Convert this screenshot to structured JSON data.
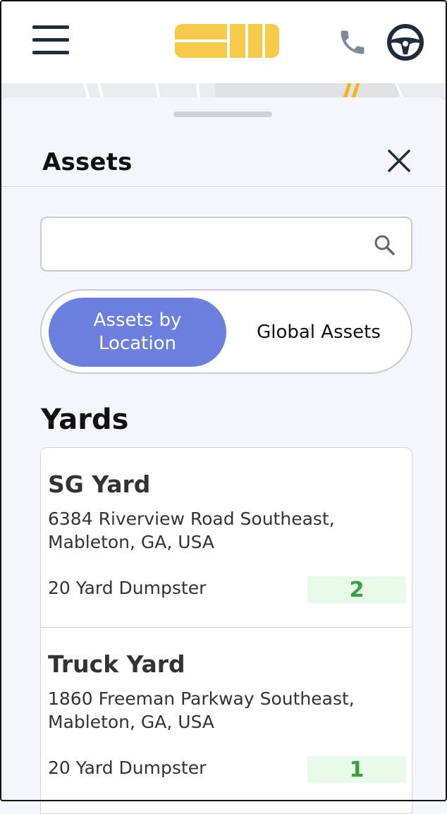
{
  "header": {
    "menu_icon": "hamburger-menu-icon",
    "logo_icon": "brand-logo",
    "phone_icon": "phone-icon",
    "wheel_icon": "steering-wheel-icon",
    "colors": {
      "logo": "#f7c948",
      "phone": "#7a8a99",
      "dark": "#1f2d3d"
    }
  },
  "sheet": {
    "title": "Assets",
    "close_icon": "close-icon",
    "search": {
      "value": "",
      "placeholder": "",
      "icon": "search-icon"
    },
    "toggle": {
      "options": [
        {
          "label_line1": "Assets by",
          "label_line2": "Location",
          "active": true
        },
        {
          "label": "Global Assets",
          "active": false
        }
      ],
      "active_color": "#6b7fdf"
    },
    "section_title": "Yards",
    "yards": [
      {
        "name": "SG Yard",
        "address_line1": "6384 Riverview Road Southeast,",
        "address_line2": "Mableton, GA, USA",
        "asset_type": "20 Yard Dumpster",
        "count": "2"
      },
      {
        "name": "Truck Yard",
        "address_line1": "1860 Freeman Parkway Southeast,",
        "address_line2": "Mableton, GA, USA",
        "asset_type": "20 Yard Dumpster",
        "count": "1"
      }
    ]
  }
}
